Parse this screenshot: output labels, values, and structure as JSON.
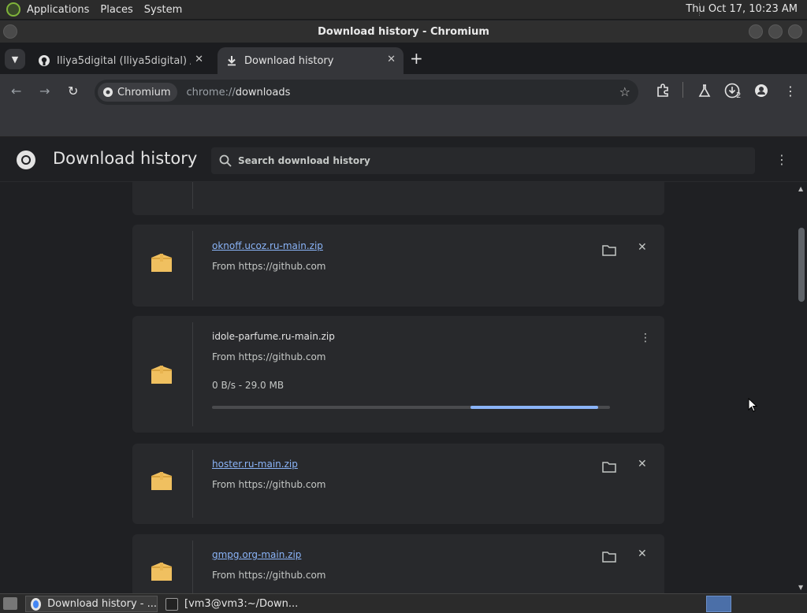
{
  "system_panel": {
    "menus": [
      "Applications",
      "Places",
      "System"
    ],
    "clock": "Thu Oct 17, 10:23 AM"
  },
  "window": {
    "title": "Download history - Chromium"
  },
  "tabs": [
    {
      "title": "Iliya5digital (Iliya5digital) / Re",
      "active": false
    },
    {
      "title": "Download history",
      "active": true
    }
  ],
  "toolbar": {
    "omnibox_chip": "Chromium",
    "url_prefix": "chrome://",
    "url_host": "downloads",
    "downloads_badge": "2"
  },
  "page": {
    "title": "Download history",
    "search_placeholder": "Search download history"
  },
  "downloads": [
    {
      "name": "oknoff.ucoz.ru-main.zip",
      "source": "From https://github.com",
      "state": "complete"
    },
    {
      "name": "idole-parfume.ru-main.zip",
      "source": "From https://github.com",
      "state": "in_progress",
      "status": "0 B/s - 29.0 MB",
      "progress": 0.32
    },
    {
      "name": "hoster.ru-main.zip",
      "source": "From https://github.com",
      "state": "complete"
    },
    {
      "name": "gmpg.org-main.zip",
      "source": "From https://github.com",
      "state": "complete"
    }
  ],
  "taskbar": {
    "items": [
      "Download history - ...",
      "[vm3@vm3:~/Down..."
    ]
  },
  "colors": {
    "accent": "#8ab4f8",
    "page_bg": "#1f2023",
    "card_bg": "#28292c",
    "toolbar_bg": "#35363a"
  }
}
